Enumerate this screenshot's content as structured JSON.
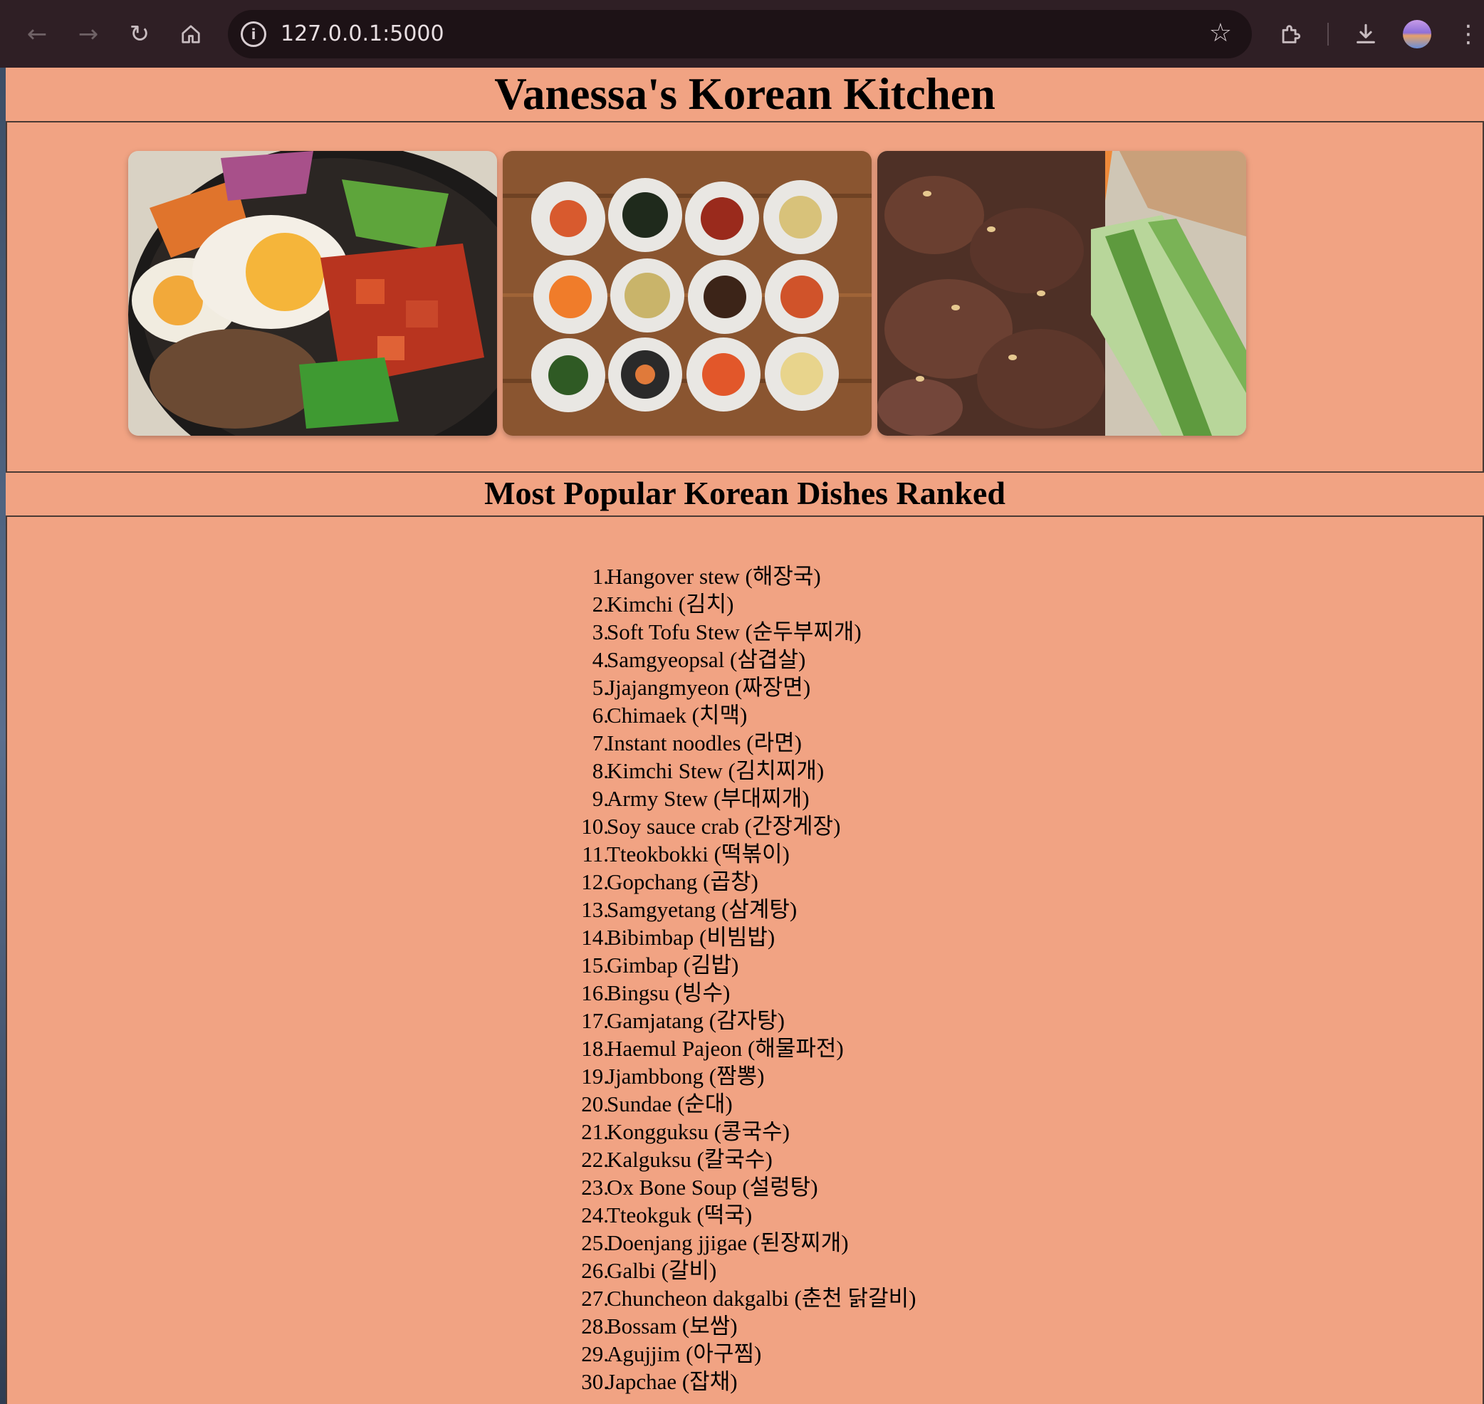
{
  "browser": {
    "url": "127.0.0.1:5000",
    "icons": [
      "back-arrow-icon",
      "forward-arrow-icon",
      "reload-icon",
      "home-icon",
      "site-info-icon",
      "bookmark-star-icon",
      "extensions-icon",
      "download-icon",
      "profile-avatar",
      "menu-dots-icon"
    ]
  },
  "page": {
    "title": "Vanessa's Korean Kitchen",
    "background": "#f1a383",
    "gallery": [
      {
        "alt": "Bibimbap"
      },
      {
        "alt": "Banchan"
      },
      {
        "alt": "Bulgogi"
      }
    ],
    "section_title": "Most Popular Korean Dishes Ranked",
    "dishes": [
      {
        "rank": "1.",
        "name": "Hangover stew (해장국)"
      },
      {
        "rank": "2.",
        "name": "Kimchi (김치)"
      },
      {
        "rank": "3.",
        "name": "Soft Tofu Stew (순두부찌개)"
      },
      {
        "rank": "4.",
        "name": "Samgyeopsal (삼겹살)"
      },
      {
        "rank": "5.",
        "name": "Jjajangmyeon (짜장면)"
      },
      {
        "rank": "6.",
        "name": "Chimaek (치맥)"
      },
      {
        "rank": "7.",
        "name": "Instant noodles (라면)"
      },
      {
        "rank": "8.",
        "name": "Kimchi Stew (김치찌개)"
      },
      {
        "rank": "9.",
        "name": "Army Stew (부대찌개)"
      },
      {
        "rank": "10.",
        "name": "Soy sauce crab (간장게장)"
      },
      {
        "rank": "11.",
        "name": "Tteokbokki (떡볶이)"
      },
      {
        "rank": "12.",
        "name": "Gopchang (곱창)"
      },
      {
        "rank": "13.",
        "name": "Samgyetang (삼계탕)"
      },
      {
        "rank": "14.",
        "name": "Bibimbap (비빔밥)"
      },
      {
        "rank": "15.",
        "name": "Gimbap (김밥)"
      },
      {
        "rank": "16.",
        "name": "Bingsu (빙수)"
      },
      {
        "rank": "17.",
        "name": "Gamjatang (감자탕)"
      },
      {
        "rank": "18.",
        "name": "Haemul Pajeon (해물파전)"
      },
      {
        "rank": "19.",
        "name": "Jjambbong (짬뽕)"
      },
      {
        "rank": "20.",
        "name": "Sundae (순대)"
      },
      {
        "rank": "21.",
        "name": "Kongguksu (콩국수)"
      },
      {
        "rank": "22.",
        "name": "Kalguksu (칼국수)"
      },
      {
        "rank": "23.",
        "name": "Ox Bone Soup (설렁탕)"
      },
      {
        "rank": "24.",
        "name": "Tteokguk (떡국)"
      },
      {
        "rank": "25.",
        "name": "Doenjang jjigae (된장찌개)"
      },
      {
        "rank": "26.",
        "name": "Galbi (갈비)"
      },
      {
        "rank": "27.",
        "name": "Chuncheon dakgalbi (춘천 닭갈비)"
      },
      {
        "rank": "28.",
        "name": "Bossam (보쌈)"
      },
      {
        "rank": "29.",
        "name": "Agujjim (아구찜)"
      },
      {
        "rank": "30.",
        "name": "Japchae (잡채)"
      }
    ]
  }
}
